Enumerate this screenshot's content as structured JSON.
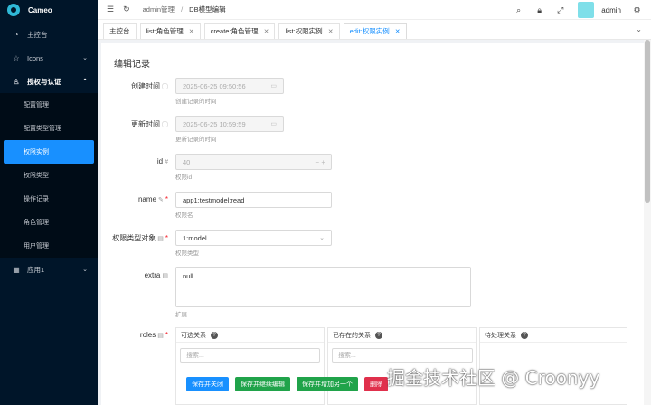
{
  "app": {
    "name": "Cameo"
  },
  "sidebar": {
    "items": [
      {
        "label": "主控台",
        "icon": "dashboard-icon"
      },
      {
        "label": "Icons",
        "icon": "star-icon",
        "caret": "⌄"
      },
      {
        "label": "授权与认证",
        "icon": "user-icon",
        "caret": "⌃"
      }
    ],
    "sub_items": [
      "配置管理",
      "配置类型管理",
      "权限实例",
      "权限类型",
      "操作记录",
      "角色管理",
      "用户管理"
    ],
    "active_sub": "权限实例",
    "bottom": {
      "label": "应用1",
      "icon": "grid-icon",
      "caret": "⌄"
    }
  },
  "header": {
    "breadcrumb": [
      "admin管理",
      "DB模型编辑"
    ],
    "separator": "/",
    "username": "admin"
  },
  "tabs": [
    {
      "label": "主控台",
      "closable": false
    },
    {
      "label": "list:角色管理",
      "closable": true
    },
    {
      "label": "create:角色管理",
      "closable": true
    },
    {
      "label": "list:权限实例",
      "closable": true
    },
    {
      "label": "edit:权限实例",
      "closable": true,
      "active": true
    }
  ],
  "form": {
    "title": "编辑记录",
    "created": {
      "label": "创建时间",
      "value": "2025-06-25 09:50:56",
      "help": "创建记录的时间"
    },
    "updated": {
      "label": "更新时间",
      "value": "2025-06-25 10:59:59",
      "help": "更新记录的时间"
    },
    "id": {
      "label": "id",
      "value": "40",
      "help": "权限id"
    },
    "name": {
      "label": "name",
      "value": "app1:testmodel:read",
      "help": "权限名"
    },
    "perm_type": {
      "label": "权限类型对象",
      "value": "1:model",
      "help": "权限类型"
    },
    "extra": {
      "label": "extra",
      "value": "null",
      "help": "扩展"
    },
    "roles": {
      "label": "roles",
      "panels": [
        {
          "title": "可选关系",
          "search_placeholder": "搜索..."
        },
        {
          "title": "已存在的关系",
          "search_placeholder": "搜索..."
        },
        {
          "title": "待处理关系"
        }
      ]
    }
  },
  "actions": {
    "save_close": "保存并关闭",
    "save_continue": "保存并继续编辑",
    "save_add": "保存并增加另一个",
    "delete": "删除"
  },
  "watermark": "掘金技术社区 @ Croonyy",
  "colors": {
    "sidebar_bg": "#001529",
    "accent": "#1890ff",
    "success": "#20a34a",
    "danger": "#e0304c"
  }
}
